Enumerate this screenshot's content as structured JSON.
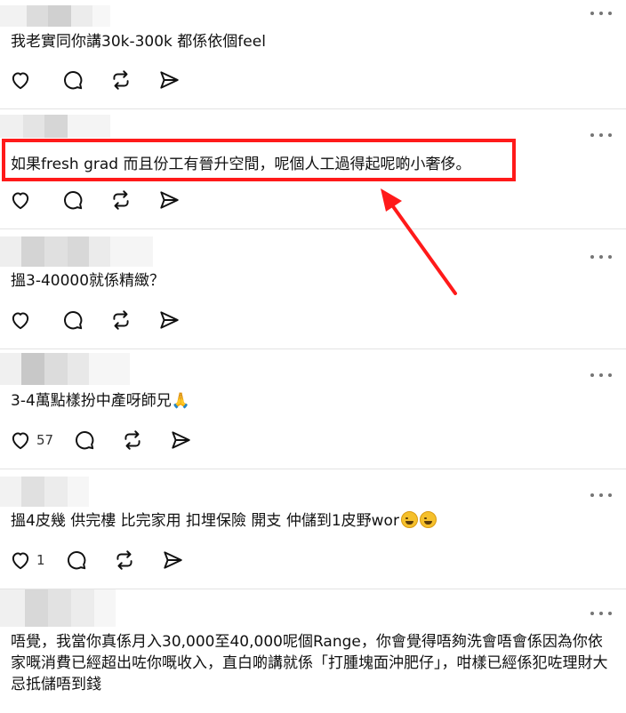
{
  "posts": [
    {
      "text": "我老實同你講30k-300k 都係依個feel",
      "likes": ""
    },
    {
      "text": "如果fresh grad 而且份工有晉升空間，呢個人工過得起呢啲小奢侈。",
      "likes": ""
    },
    {
      "text": "搵3-40000就係精緻？",
      "likes": ""
    },
    {
      "text": "3-4萬點樣扮中產呀師兄🙏",
      "likes": "57"
    },
    {
      "text": "搵4皮幾 供完樓 比完家用 扣埋保險 開支 仲儲到1皮野wor",
      "likes": "1",
      "emojis": [
        "sweat-smile-emoji",
        "laughing-tears-emoji"
      ]
    },
    {
      "text": "唔覺，我當你真係月入30,000至40,000呢個Range，你會覺得唔夠洗會唔會係因為你依家嘅消費已經超出咗你嘅收入，直白啲講就係「打腫塊面沖肥仔」，咁樣已經係犯咗理財大忌抵儲唔到錢",
      "likes": ""
    }
  ],
  "icons": {
    "like": "heart-icon",
    "comment": "comment-bubble-icon",
    "repost": "repost-icon",
    "share": "send-icon",
    "more": "more-options-icon"
  },
  "colors": {
    "highlight": "#ff1a1a",
    "icon": "#111111",
    "divider": "#e3e3e3"
  }
}
